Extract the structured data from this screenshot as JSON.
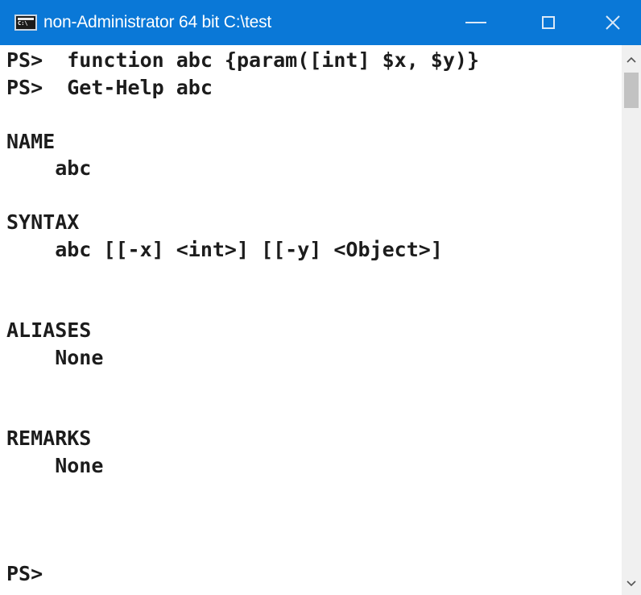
{
  "window": {
    "title": "non-Administrator 64 bit C:\\test",
    "icon": "console-app-icon",
    "titlebar_color": "#0a78d7",
    "controls": [
      "minimize-icon",
      "maximize-icon",
      "close-icon"
    ]
  },
  "console": {
    "lines": [
      "PS>  function abc {param([int] $x, $y)}",
      "PS>  Get-Help abc",
      "",
      "NAME",
      "    abc",
      "",
      "SYNTAX",
      "    abc [[-x] <int>] [[-y] <Object>]",
      "",
      "",
      "ALIASES",
      "    None",
      "",
      "",
      "REMARKS",
      "    None",
      "",
      "",
      "",
      "PS>"
    ]
  },
  "scrollbar": {
    "up_icon": "chevron-up-icon",
    "down_icon": "chevron-down-icon"
  }
}
